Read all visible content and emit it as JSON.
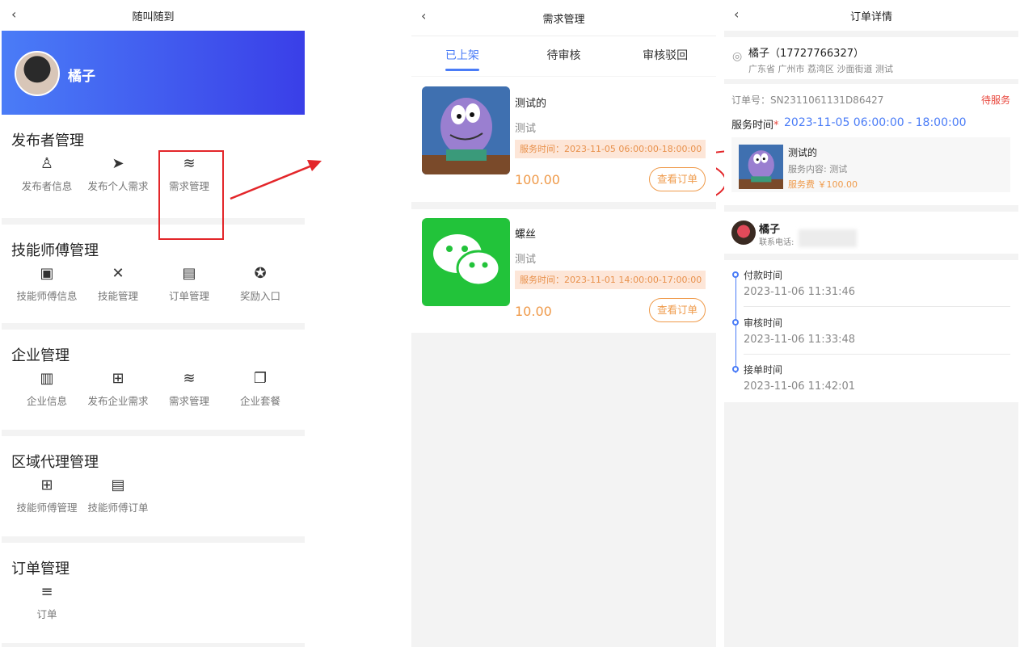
{
  "panel1": {
    "title": "随叫随到",
    "profile_name": "橘子",
    "sections": [
      {
        "title": "发布者管理",
        "items": [
          {
            "label": "发布者信息",
            "icon": "user-icon",
            "glyph": "♙"
          },
          {
            "label": "发布个人需求",
            "icon": "send-icon",
            "glyph": "➤"
          },
          {
            "label": "需求管理",
            "icon": "layers-icon",
            "glyph": "≋"
          }
        ]
      },
      {
        "title": "技能师傅管理",
        "items": [
          {
            "label": "技能师傅信息",
            "icon": "id-card-icon",
            "glyph": "▣"
          },
          {
            "label": "技能管理",
            "icon": "tools-icon",
            "glyph": "✕"
          },
          {
            "label": "订单管理",
            "icon": "clipboard-icon",
            "glyph": "▤"
          },
          {
            "label": "奖励入口",
            "icon": "award-icon",
            "glyph": "✪"
          }
        ]
      },
      {
        "title": "企业管理",
        "items": [
          {
            "label": "企业信息",
            "icon": "building-icon",
            "glyph": "▥"
          },
          {
            "label": "发布企业需求",
            "icon": "folder-plus-icon",
            "glyph": "⊞"
          },
          {
            "label": "需求管理",
            "icon": "layers-icon",
            "glyph": "≋"
          },
          {
            "label": "企业套餐",
            "icon": "copy-icon",
            "glyph": "❐"
          }
        ]
      },
      {
        "title": "区域代理管理",
        "items": [
          {
            "label": "技能师傅管理",
            "icon": "apps-icon",
            "glyph": "⊞"
          },
          {
            "label": "技能师傅订单",
            "icon": "inbox-icon",
            "glyph": "▤"
          }
        ]
      },
      {
        "title": "订单管理",
        "items": [
          {
            "label": "订单",
            "icon": "list-icon",
            "glyph": "≡"
          }
        ]
      }
    ]
  },
  "panel2": {
    "title": "需求管理",
    "tabs": [
      {
        "label": "已上架",
        "active": true
      },
      {
        "label": "待审核",
        "active": false
      },
      {
        "label": "审核驳回",
        "active": false
      }
    ],
    "cards": [
      {
        "title": "测试的",
        "desc": "测试",
        "time": "服务时间：2023-11-05 06:00:00-18:00:00",
        "price": "100.00",
        "button": "查看订单"
      },
      {
        "title": "螺丝",
        "desc": "测试",
        "time": "服务时间：2023-11-01 14:00:00-17:00:00",
        "price": "10.00",
        "button": "查看订单"
      }
    ]
  },
  "panel3": {
    "title": "订单详情",
    "contact_name": "橘子（17727766327）",
    "address": "广东省 广州市 荔湾区 沙面街道 测试",
    "order_no": "订单号：SN2311061131D86427",
    "status": "待服务",
    "service_time_label": "服务时间",
    "required_mark": "*",
    "service_time": "2023-11-05 06:00:00 - 18:00:00",
    "item_title": "测试的",
    "item_content": "服务内容: 测试",
    "item_fee_label": "服务费",
    "item_fee": "￥100.00",
    "worker_name": "橘子",
    "worker_phone_label": "联系电话:",
    "timeline": [
      {
        "label": "付款时间",
        "time": "2023-11-06 11:31:46"
      },
      {
        "label": "审核时间",
        "time": "2023-11-06 11:33:48"
      },
      {
        "label": "接单时间",
        "time": "2023-11-06 11:42:01"
      }
    ]
  },
  "colors": {
    "primary": "#4a7cf7",
    "accent_orange": "#ef9a4a",
    "annotation_red": "#e3262a",
    "status_red": "#e8443a"
  }
}
